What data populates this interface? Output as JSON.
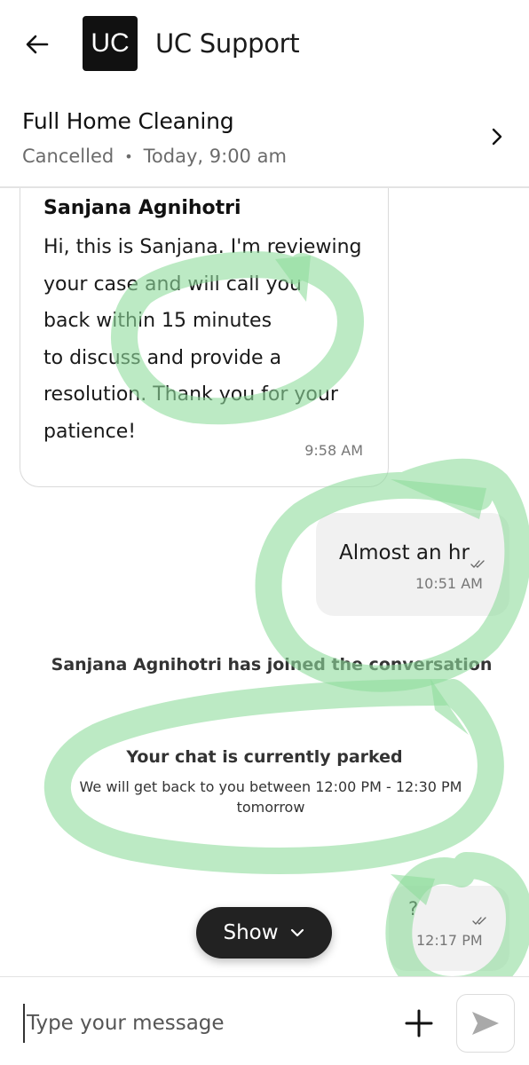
{
  "header": {
    "back_icon": "arrow-left-icon",
    "logo_text": "UC",
    "title": "UC Support"
  },
  "booking": {
    "title": "Full Home Cleaning",
    "status": "Cancelled",
    "separator": "•",
    "schedule": "Today, 9:00 am",
    "chevron_icon": "chevron-right-icon"
  },
  "messages": {
    "agent_message": {
      "sender": "Sanjana Agnihotri",
      "text": "Hi, this is Sanjana. I'm reviewing\nyour case and will call you\nback within 15 minutes\nto discuss and provide a\nresolution. Thank you for your\npatience!",
      "time": "9:58 AM"
    },
    "user_message_1": {
      "text": "Almost an hr",
      "time": "10:51 AM",
      "status_icon": "double-check-icon"
    },
    "system_joined": "Sanjana Agnihotri has joined the conversation",
    "parked_notice": {
      "title": "Your chat is currently parked",
      "subtitle": "We will get back to you between 12:00 PM - 12:30 PM tomorrow"
    },
    "user_message_2": {
      "text": "?",
      "time": "12:17 PM",
      "status_icon": "double-check-icon"
    }
  },
  "show_button": {
    "label": "Show",
    "icon": "chevron-down-icon"
  },
  "composer": {
    "placeholder": "Type your message",
    "add_icon": "plus-icon",
    "send_icon": "send-icon"
  },
  "colors": {
    "highlight": "#8fdc9c",
    "bubble_bg": "#f1f1f1",
    "pill_bg": "#222222"
  }
}
